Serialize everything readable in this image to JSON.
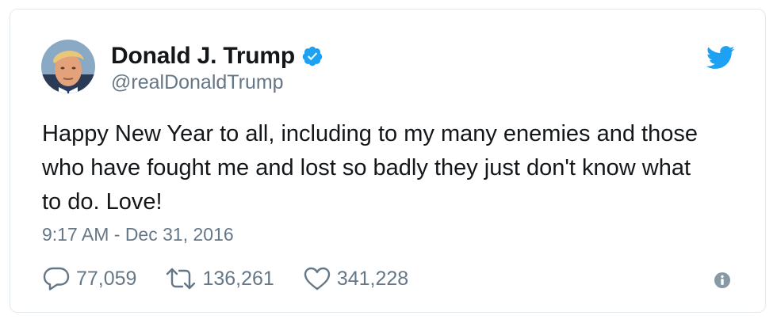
{
  "user": {
    "display_name": "Donald J. Trump",
    "handle": "@realDonaldTrump",
    "verified": true
  },
  "tweet": {
    "text": "Happy New Year to all, including to my many enemies and those\nwho have fought me and lost so badly they just don't know what\nto do. Love!",
    "timestamp": "9:17 AM - Dec 31, 2016"
  },
  "actions": {
    "replies": "77,059",
    "retweets": "136,261",
    "likes": "341,228"
  },
  "icons": {
    "bird": "twitter-bird-icon",
    "verified": "verified-badge-icon",
    "reply": "reply-icon",
    "retweet": "retweet-icon",
    "like": "heart-icon",
    "info": "info-icon"
  },
  "colors": {
    "brand": "#1da1f2",
    "text": "#14171a",
    "secondary": "#657786",
    "border": "#e1e8ed",
    "icon_gray": "#657786"
  }
}
